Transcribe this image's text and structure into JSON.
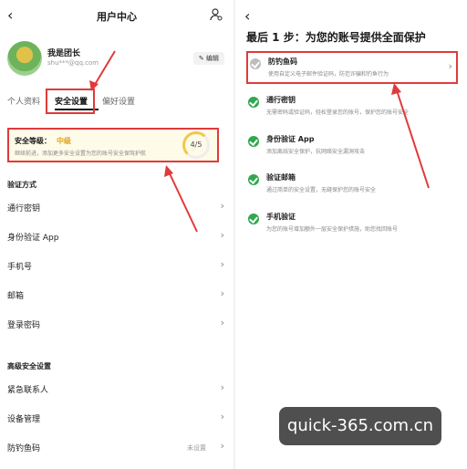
{
  "left": {
    "back": "‹",
    "title": "用户中心",
    "profile": {
      "name": "我是团长",
      "email": "shu***@qq.com",
      "edit_label": "✎ 编辑"
    },
    "tabs": [
      "个人资料",
      "安全设置",
      "偏好设置"
    ],
    "security": {
      "label": "安全等级：",
      "value": "中级",
      "desc": "继续前进，添加更多安全设置为您的账号安全保驾护航",
      "progress": "4/5"
    },
    "section_verify": "验证方式",
    "verify_items": [
      "通行密钥",
      "身份验证 App",
      "手机号",
      "邮箱",
      "登录密码"
    ],
    "section_advanced": "高级安全设置",
    "advanced_items": [
      {
        "label": "紧急联系人",
        "extra": ""
      },
      {
        "label": "设备管理",
        "extra": ""
      },
      {
        "label": "防钓鱼码",
        "extra": "未设置"
      }
    ]
  },
  "right": {
    "back": "‹",
    "title": "最后 1 步：为您的账号提供全面保护",
    "items": [
      {
        "name": "防钓鱼码",
        "desc": "使用自定义电子邮件验证码，防范诈骗和钓鱼行为",
        "done": false
      },
      {
        "name": "通行密钥",
        "desc": "无需密码或验证码，轻松登录您的账号，保护您的账号安全",
        "done": true
      },
      {
        "name": "身份验证 App",
        "desc": "添加离线安全保护，抗网络安全漏洞攻击",
        "done": true
      },
      {
        "name": "验证邮箱",
        "desc": "通过简单的安全设置，无缝保护您的账号安全",
        "done": true
      },
      {
        "name": "手机验证",
        "desc": "为您的账号增加额外一层安全保护措施，助您找回账号",
        "done": true
      }
    ]
  },
  "chevron": "›",
  "watermark": "quick-365.com.cn",
  "colors": {
    "highlight": "#e03a3a",
    "check": "#2fa84f",
    "level": "#e0a21e"
  }
}
